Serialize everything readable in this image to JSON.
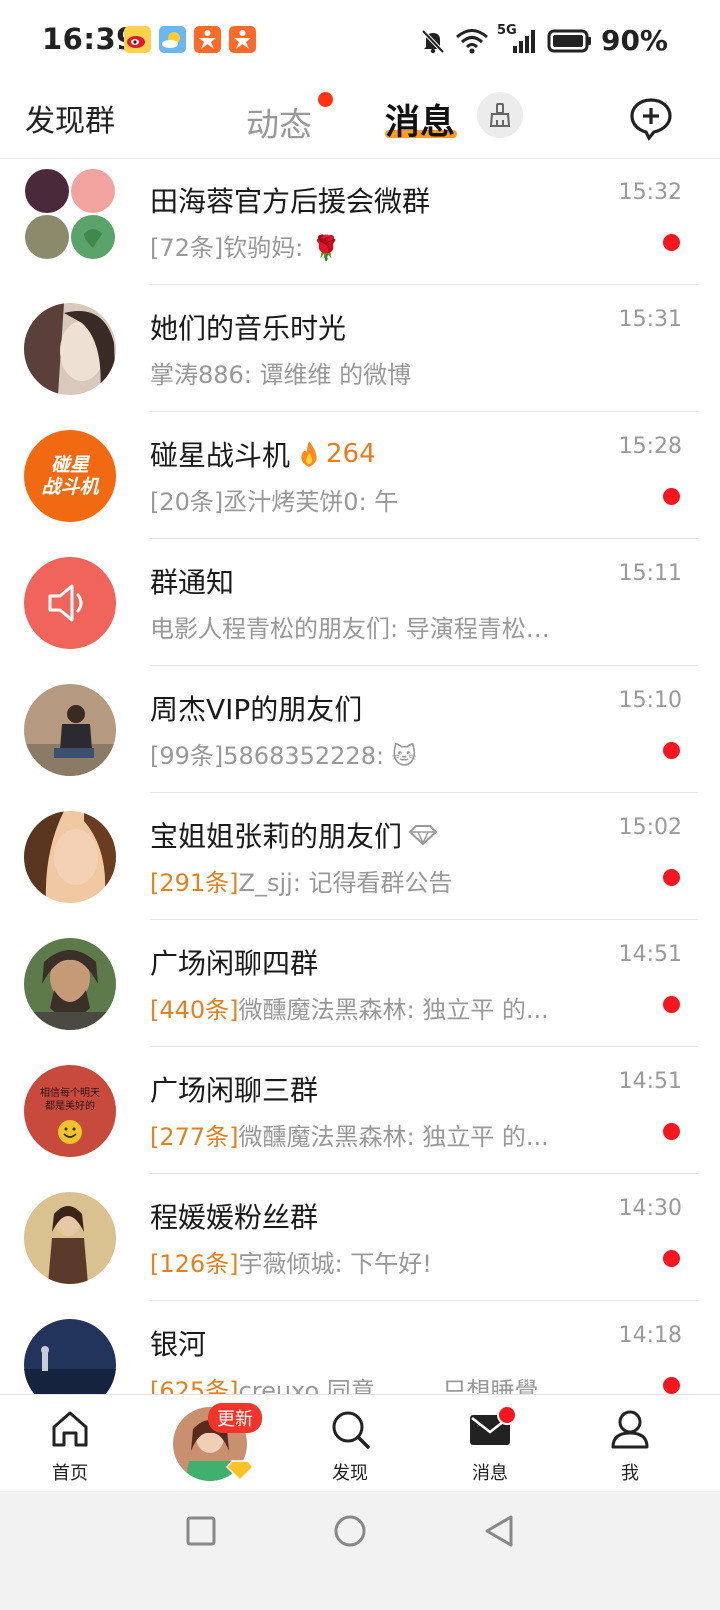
{
  "status_bar": {
    "time": "16:39",
    "network": "5G",
    "battery": "90%",
    "app_icons": [
      "weibo-icon",
      "weather-icon",
      "app-icon-1",
      "app-icon-2"
    ],
    "indicator_icons": [
      "mute-bell-icon",
      "wifi-icon",
      "signal-icon",
      "battery-icon"
    ]
  },
  "header": {
    "left_label": "发现群",
    "tab_feed": "动态",
    "tab_messages": "消息",
    "accent": "#ff9d1a"
  },
  "conversations": [
    {
      "name": "田海蓉官方后援会微群",
      "count": "",
      "preview": "[72条]钦驹妈: 🌹",
      "time": "15:32",
      "unread": true
    },
    {
      "name": "她们的音乐时光",
      "count": "",
      "preview": "掌涛886: 谭维维 的微博",
      "time": "15:31",
      "unread": false
    },
    {
      "name": "碰星战斗机",
      "hot": "264",
      "count": "",
      "preview": "[20条]丞汁烤芙饼0: 午",
      "time": "15:28",
      "unread": true,
      "avatar_text": "碰星\n战斗机"
    },
    {
      "name": "群通知",
      "count": "",
      "preview": "电影人程青松的朋友们: 导演程青松…",
      "time": "15:11",
      "unread": false
    },
    {
      "name": "周杰VIP的朋友们",
      "count": "",
      "preview": "[99条]5868352228: 🐱",
      "time": "15:10",
      "unread": true
    },
    {
      "name": "宝姐姐张莉的朋友们",
      "count": "[291条]",
      "preview": "Z_sjj: 记得看群公告",
      "time": "15:02",
      "unread": true
    },
    {
      "name": "广场闲聊四群",
      "count": "[440条]",
      "preview": "微醺魔法黑森林: 独立平 的...",
      "time": "14:51",
      "unread": true
    },
    {
      "name": "广场闲聊三群",
      "count": "[277条]",
      "preview": "微醺魔法黑森林: 独立平 的...",
      "time": "14:51",
      "unread": true,
      "avatar_text": "相信每个明天\n都是美好的"
    },
    {
      "name": "程媛媛粉丝群",
      "count": "[126条]",
      "preview": "宇薇倾城: 下午好!",
      "time": "14:30",
      "unread": true
    },
    {
      "name": "银河",
      "count": "[625条]",
      "preview": "creuxo 同意 _____只想睡覺 ...",
      "time": "14:18",
      "unread": true
    }
  ],
  "bottom_nav": {
    "home": "首页",
    "update_badge": "更新",
    "discover": "发现",
    "messages": "消息",
    "me": "我"
  }
}
